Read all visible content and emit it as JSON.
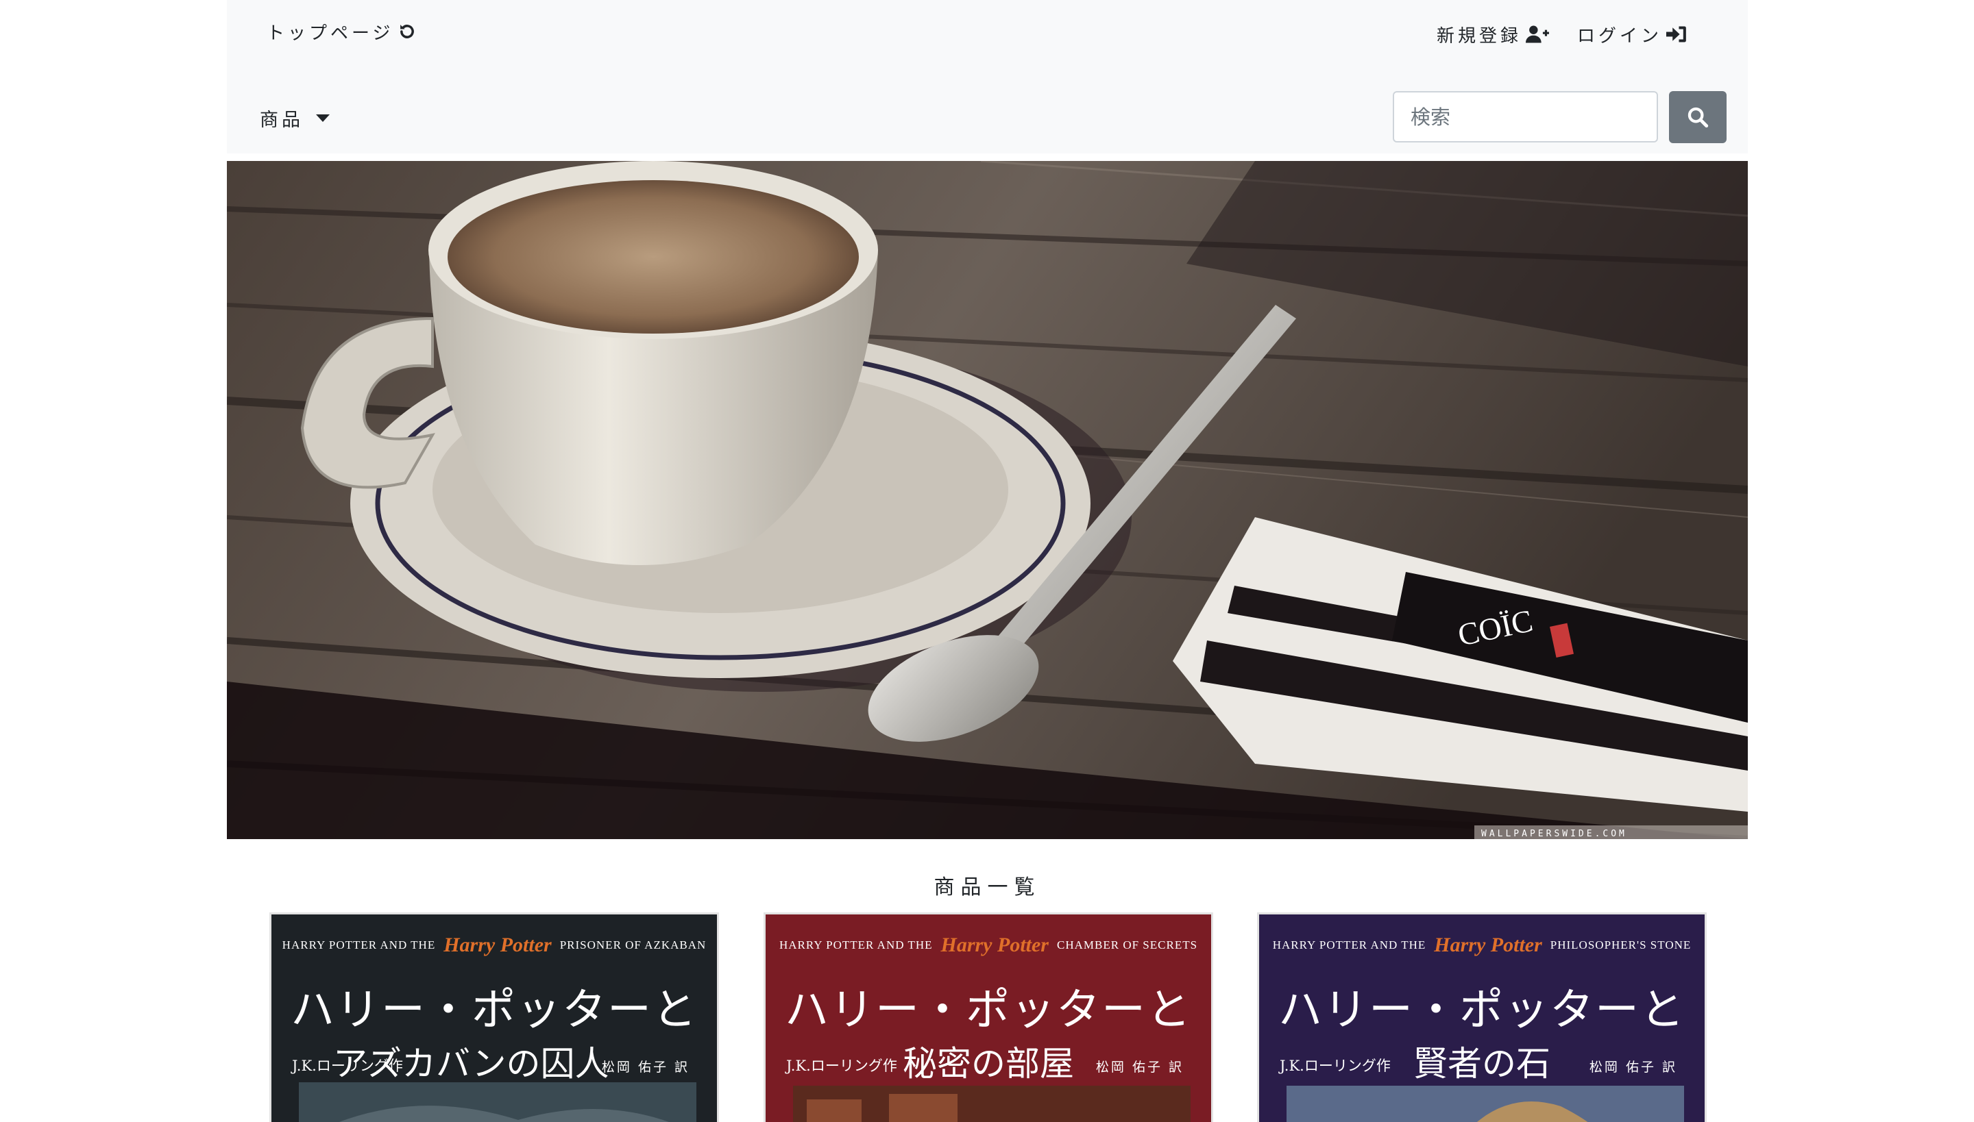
{
  "nav": {
    "top_label": "トップページ",
    "signup_label": "新規登録",
    "login_label": "ログイン",
    "products_label": "商品"
  },
  "search": {
    "placeholder": "検索"
  },
  "icons": {
    "top": "refresh-icon",
    "signup": "user-plus-icon",
    "login": "sign-in-icon",
    "dropdown": "caret-down-icon",
    "search": "search-icon"
  },
  "colors": {
    "navbar_bg": "#f8f9fa",
    "search_button": "#6c757d",
    "book_1": "#1d2226",
    "book_2": "#7a1c24",
    "book_3": "#2a1d4a",
    "harry_potter_logo": "#e0702a"
  },
  "hero": {
    "watermark": "WALLPAPERSWIDE.COM",
    "wrapper_text": "COÏC"
  },
  "section": {
    "title": "商品一覧"
  },
  "products": [
    {
      "header_left": "HARRY POTTER AND THE",
      "logo": "Harry Potter",
      "header_right": "PRISONER OF AZKABAN",
      "title": "ハリー・ポッターと",
      "author": "J.K.ローリング作",
      "subtitle": "アズカバンの囚人",
      "translator": "松岡 佑子 訳"
    },
    {
      "header_left": "HARRY POTTER AND THE",
      "logo": "Harry Potter",
      "header_right": "CHAMBER OF SECRETS",
      "title": "ハリー・ポッターと",
      "author": "J.K.ローリング作",
      "subtitle": "秘密の部屋",
      "translator": "松岡 佑子 訳"
    },
    {
      "header_left": "HARRY POTTER AND THE",
      "logo": "Harry Potter",
      "header_right": "PHILOSOPHER'S STONE",
      "title": "ハリー・ポッターと",
      "author": "J.K.ローリング作",
      "subtitle": "賢者の石",
      "translator": "松岡 佑子 訳"
    }
  ]
}
